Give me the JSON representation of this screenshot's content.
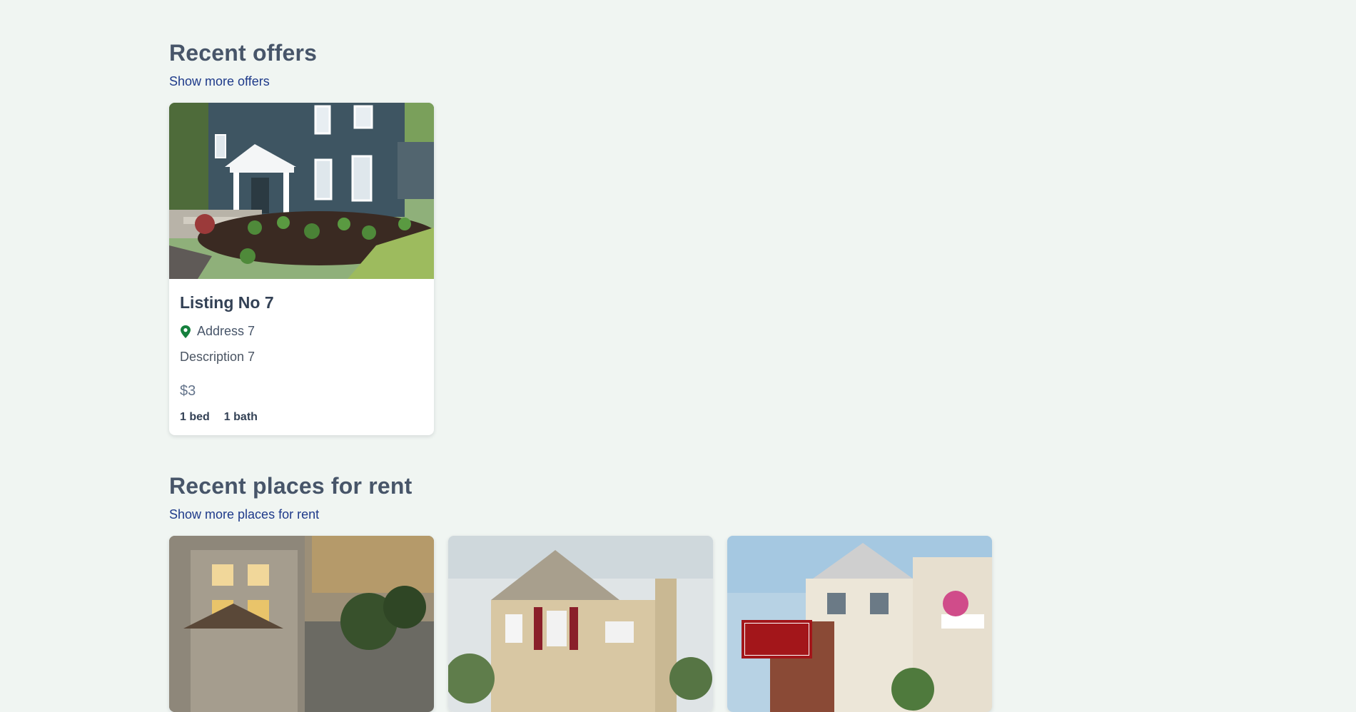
{
  "offers": {
    "title": "Recent offers",
    "link": "Show more offers",
    "listings": [
      {
        "title": "Listing No 7",
        "address": "Address 7",
        "description": "Description 7",
        "price": "$3",
        "beds": "1 bed",
        "baths": "1 bath"
      }
    ]
  },
  "rent": {
    "title": "Recent places for rent",
    "link": "Show more places for rent"
  },
  "colors": {
    "background": "#f0f5f2",
    "link": "#1e3a8a",
    "pin": "#15803d"
  }
}
